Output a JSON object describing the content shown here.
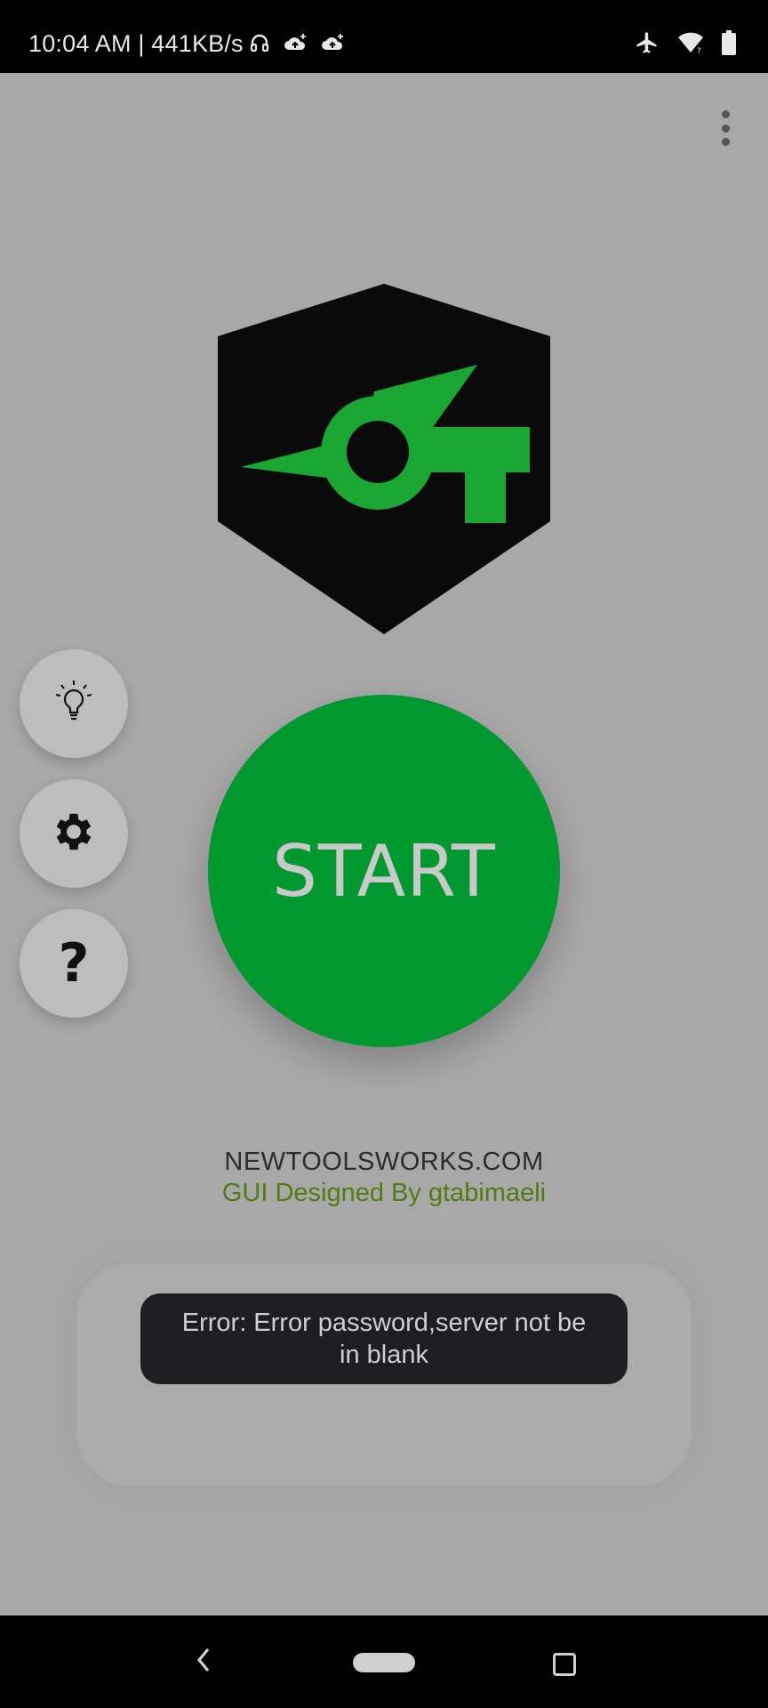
{
  "status_bar": {
    "text": "10:04 AM | 441KB/s",
    "left_icons": [
      "headphones-icon",
      "cloud-upload-icon",
      "cloud-upload-icon"
    ],
    "right_icons": [
      "airplane-mode-icon",
      "wifi-icon",
      "battery-icon"
    ]
  },
  "toolbar": {
    "overflow_icon": "more-vert-icon"
  },
  "logo": {
    "background": "#0a0a0a",
    "accent": "#1aa632"
  },
  "side_buttons": [
    {
      "name": "tips",
      "icon": "lightbulb-icon"
    },
    {
      "name": "settings",
      "icon": "gear-icon"
    },
    {
      "name": "help",
      "label": "?"
    }
  ],
  "start_button": {
    "label": "START",
    "color": "#009930"
  },
  "credits": {
    "site": "NEWTOOLSWORKS.COM",
    "gui": "GUI  Designed By gtabimaeli"
  },
  "toast": {
    "message": "Error: Error password,server  not be in blank"
  },
  "nav_bar": {
    "icons": [
      "back-icon",
      "home-pill-icon",
      "recents-icon"
    ]
  }
}
